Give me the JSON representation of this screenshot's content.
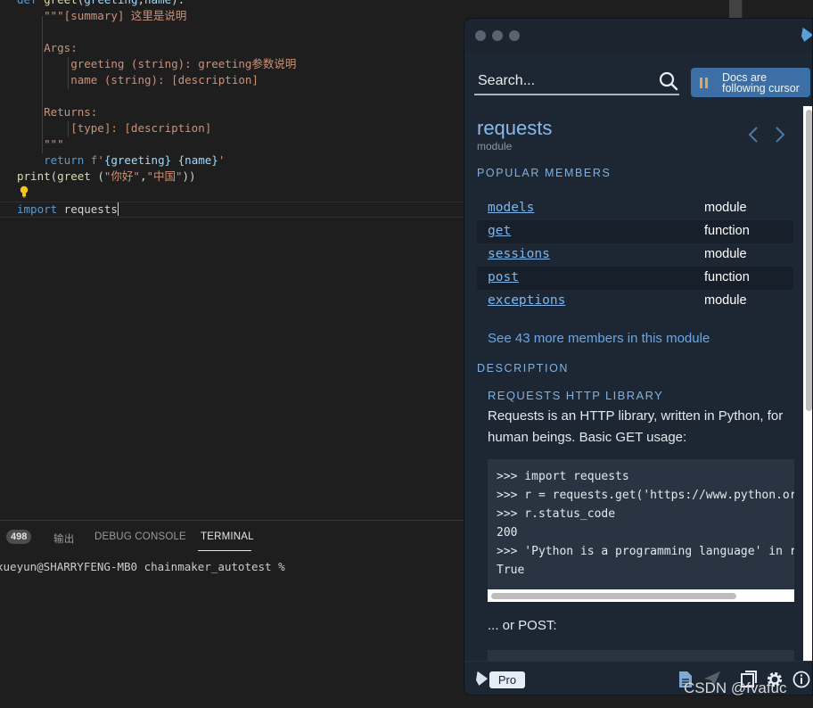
{
  "editor": {
    "lines": [
      "def greet(greeting,name):",
      "    \"\"\"[summary] 这里是说明",
      "",
      "    Args:",
      "        greeting (string): greeting参数说明",
      "        name (string): [description]",
      "",
      "    Returns:",
      "        [type]: [description]",
      "    \"\"\"",
      "    return f'{greeting} {name}'",
      "print(greet (\"你好\",\"中国\"))",
      "",
      "import requests"
    ]
  },
  "panel": {
    "badge": "498",
    "tabs": [
      "输出",
      "DEBUG CONSOLE",
      "TERMINAL"
    ],
    "active_tab": "TERMINAL",
    "terminal_line": "xueyun@SHARRYFENG-MB0 chainmaker_autotest %"
  },
  "kite": {
    "search_placeholder": "Search...",
    "follow_button": [
      "Docs are",
      "following cursor"
    ],
    "title": "requests",
    "kind": "module",
    "popular_members_heading": "POPULAR MEMBERS",
    "members": [
      {
        "name": "models",
        "type": "module"
      },
      {
        "name": "get",
        "type": "function"
      },
      {
        "name": "sessions",
        "type": "module"
      },
      {
        "name": "post",
        "type": "function"
      },
      {
        "name": "exceptions",
        "type": "module"
      }
    ],
    "more_link": "See 43 more members in this module",
    "description_heading": "DESCRIPTION",
    "library_heading": "REQUESTS HTTP LIBRARY",
    "description": "Requests is an HTTP library, written in Python, for human beings. Basic GET usage:",
    "code_lines": [
      ">>> import requests",
      ">>> r = requests.get('https://www.python.org')",
      ">>> r.status_code",
      "200",
      ">>> 'Python is a programming language' in r.content",
      "True"
    ],
    "or_post": "... or POST:",
    "pro_label": "Pro"
  },
  "watermark": "CSDN @fvafuc",
  "colors": {
    "editor_bg": "#1e1e1e",
    "kite_bg": "#1c2733",
    "accent": "#3b6fa5",
    "link": "#7eb6ee"
  }
}
